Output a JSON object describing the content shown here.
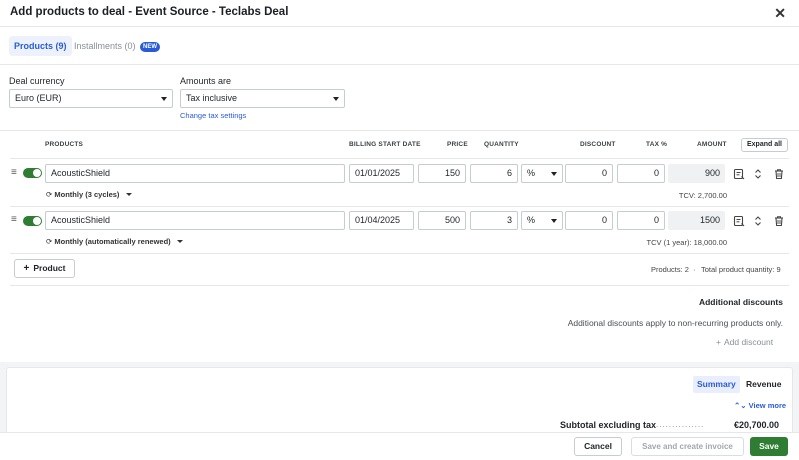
{
  "modal": {
    "title": "Add products to deal - Event Source - Teclabs Deal"
  },
  "tabs": [
    {
      "label": "Products (9)"
    },
    {
      "label": "Installments (0)",
      "badge": "NEW"
    }
  ],
  "settings": {
    "currency_label": "Deal currency",
    "currency_value": "Euro (EUR)",
    "amounts_label": "Amounts are",
    "amounts_value": "Tax inclusive",
    "change_tax_link": "Change tax settings"
  },
  "table": {
    "headers": [
      "PRODUCTS",
      "BILLING START DATE",
      "PRICE",
      "QUANTITY",
      "DISCOUNT",
      "TAX %",
      "AMOUNT"
    ],
    "expand_all": "Expand all",
    "rows": [
      {
        "product": "AcousticShield",
        "billing_start": "01/01/2025",
        "price": "150",
        "quantity": "6",
        "discount_type": "%",
        "discount": "0",
        "tax": "0",
        "amount": "900",
        "cycle": "Monthly (3 cycles)",
        "tcv": "TCV: 2,700.00"
      },
      {
        "product": "AcousticShield",
        "billing_start": "01/04/2025",
        "price": "500",
        "quantity": "3",
        "discount_type": "%",
        "discount": "0",
        "tax": "0",
        "amount": "1500",
        "cycle": "Monthly (automatically renewed)",
        "tcv": "TCV (1 year): 18,000.00"
      }
    ],
    "add_product": "Product",
    "products_count": "Products: 2",
    "total_quantity": "Total product quantity: 9"
  },
  "discounts": {
    "title": "Additional discounts",
    "note": "Additional discounts apply to non-recurring products only.",
    "add_label": "Add discount"
  },
  "summary": {
    "tab_summary": "Summary",
    "tab_revenue": "Revenue",
    "view_more": "View more",
    "subtotal_label": "Subtotal excluding tax",
    "subtotal_value": "€20,700.00"
  },
  "footer": {
    "cancel": "Cancel",
    "save_create_invoice": "Save and create invoice",
    "save": "Save"
  },
  "colors": {
    "accent": "#2a5bd7",
    "success": "#2e7d32"
  }
}
